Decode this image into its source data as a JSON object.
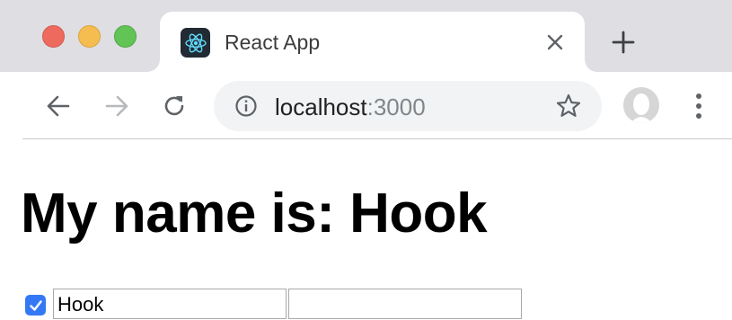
{
  "browser": {
    "tab": {
      "title": "React App",
      "favicon": "react-logo-icon"
    },
    "address": {
      "host": "localhost",
      "port": ":3000"
    },
    "icons": {
      "back": "arrow-left-icon",
      "forward": "arrow-right-icon",
      "reload": "reload-icon",
      "info": "info-icon",
      "bookmark": "star-icon",
      "menu": "kebab-menu-icon",
      "close_tab": "close-icon",
      "new_tab": "plus-icon"
    },
    "colors": {
      "close": "#ee6a5f",
      "minimize": "#f5bd4f",
      "maximize": "#61c454",
      "react_blue": "#61dafb",
      "checkbox_blue": "#3478f6"
    }
  },
  "page": {
    "heading": "My name is: Hook",
    "checkbox_checked": true,
    "inputs": [
      {
        "value": "Hook"
      },
      {
        "value": ""
      }
    ]
  }
}
